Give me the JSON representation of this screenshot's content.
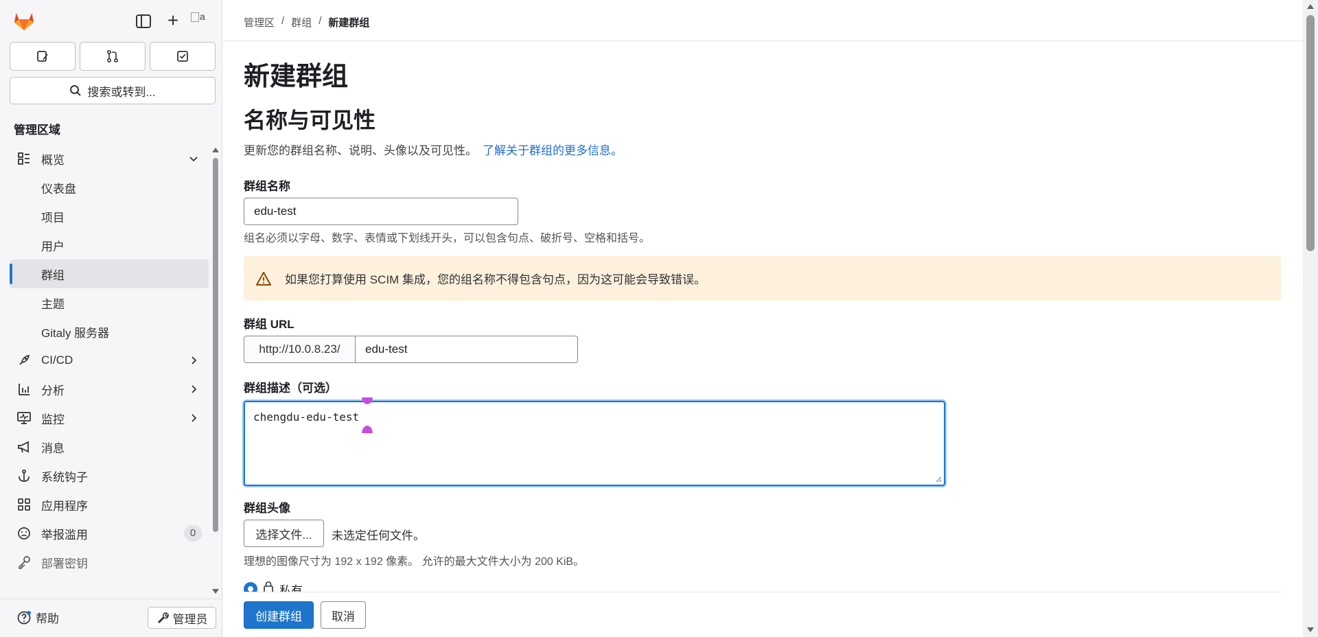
{
  "sidebar": {
    "avatar_alt": "a",
    "search_label": "搜索或转到...",
    "area_title": "管理区域",
    "items": [
      {
        "label": "概览",
        "icon": "overview-icon",
        "expanded": true
      },
      {
        "label": "仪表盘"
      },
      {
        "label": "项目"
      },
      {
        "label": "用户"
      },
      {
        "label": "群组",
        "active": true
      },
      {
        "label": "主题"
      },
      {
        "label": "Gitaly 服务器"
      },
      {
        "label": "CI/CD",
        "icon": "rocket-icon"
      },
      {
        "label": "分析",
        "icon": "chart-icon"
      },
      {
        "label": "监控",
        "icon": "monitor-icon"
      },
      {
        "label": "消息",
        "icon": "megaphone-icon"
      },
      {
        "label": "系统钩子",
        "icon": "anchor-icon"
      },
      {
        "label": "应用程序",
        "icon": "apps-icon"
      },
      {
        "label": "举报滥用",
        "icon": "abuse-icon",
        "badge": "0"
      },
      {
        "label": "部署密钥",
        "icon": "key-icon"
      }
    ],
    "help_label": "帮助",
    "admin_label": "管理员"
  },
  "breadcrumb": [
    "管理区",
    "群组",
    "新建群组"
  ],
  "page": {
    "title": "新建群组",
    "section_title": "名称与可见性",
    "section_desc": "更新您的群组名称、说明、头像以及可见性。",
    "section_link": "了解关于群组的更多信息。",
    "name_label": "群组名称",
    "name_value": "edu-test",
    "name_hint": "组名必须以字母、数字、表情或下划线开头，可以包含句点、破折号、空格和括号。",
    "alert_text": "如果您打算使用 SCIM 集成，您的组名称不得包含句点，因为这可能会导致错误。",
    "url_label": "群组 URL",
    "url_prefix": "http://10.0.8.23/",
    "url_value": "edu-test",
    "desc_label": "群组描述（可选）",
    "desc_value": "chengdu-edu-test",
    "avatar_label": "群组头像",
    "file_button": "选择文件...",
    "file_status": "未选定任何文件。",
    "avatar_hint": "理想的图像尺寸为 192 x 192 像素。 允许的最大文件大小为 200 KiB。",
    "visibility_private": "私有",
    "create_button": "创建群组",
    "cancel_button": "取消"
  },
  "colors": {
    "primary": "#1f75cb",
    "alert_bg": "#fdf1dd",
    "link": "#1f6fd0",
    "cursor": "#c44dde"
  }
}
